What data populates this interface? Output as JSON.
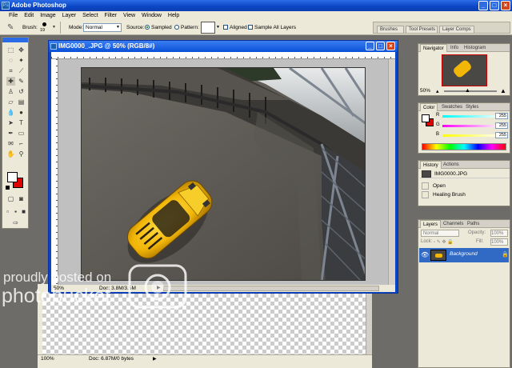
{
  "app": {
    "title": "Adobe Photoshop",
    "icon": "photoshop-logo-icon"
  },
  "window_controls": [
    "minimize-icon",
    "maximize-icon",
    "close-icon"
  ],
  "menu": [
    "File",
    "Edit",
    "Image",
    "Layer",
    "Select",
    "Filter",
    "View",
    "Window",
    "Help"
  ],
  "options": {
    "brush_label": "Brush:",
    "brush_size": "19",
    "mode_label": "Mode:",
    "mode_value": "Normal",
    "source_label": "Source:",
    "sampled_label": "Sampled",
    "pattern_label": "Pattern:",
    "aligned_label": "Aligned",
    "sample_all_label": "Sample All Layers"
  },
  "palette_well": [
    "Brushes",
    "Tool Presets",
    "Layer Comps"
  ],
  "document": {
    "title": "IMG0000_.JPG @ 50% (RGB/8#)",
    "zoom": "50%",
    "doc_status": "Doc: 3.8M/3.5M"
  },
  "document2": {
    "zoom": "100%",
    "doc_status": "Doc: 6.87M/0 bytes"
  },
  "navigator": {
    "tabs": [
      "Navigator",
      "Info",
      "Histogram"
    ],
    "zoom": "50%"
  },
  "color": {
    "tabs": [
      "Color",
      "Swatches",
      "Styles"
    ],
    "channels": [
      {
        "label": "R",
        "value": "255"
      },
      {
        "label": "G",
        "value": "255"
      },
      {
        "label": "B",
        "value": "255"
      }
    ],
    "foreground": "#ffffff",
    "background": "#e00000"
  },
  "history": {
    "tabs": [
      "History",
      "Actions"
    ],
    "snapshot": "IMG0000.JPG",
    "items": [
      "Open",
      "Healing Brush"
    ]
  },
  "layers": {
    "tabs": [
      "Layers",
      "Channels",
      "Paths"
    ],
    "blend_mode": "Normal",
    "opacity_label": "Opacity:",
    "opacity_value": "100%",
    "lock_label": "Lock:",
    "fill_label": "Fill:",
    "fill_value": "100%",
    "layer_name": "Background"
  },
  "watermark": {
    "line1": "proudly hosted on",
    "line2": "photobucket"
  }
}
